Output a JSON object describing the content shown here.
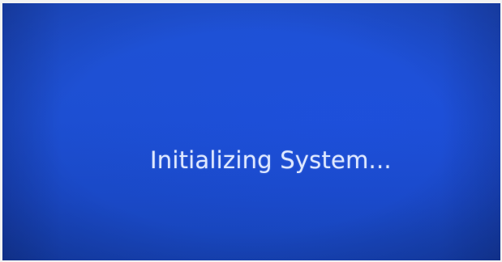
{
  "boot_screen": {
    "status_message": "Initializing System..."
  }
}
